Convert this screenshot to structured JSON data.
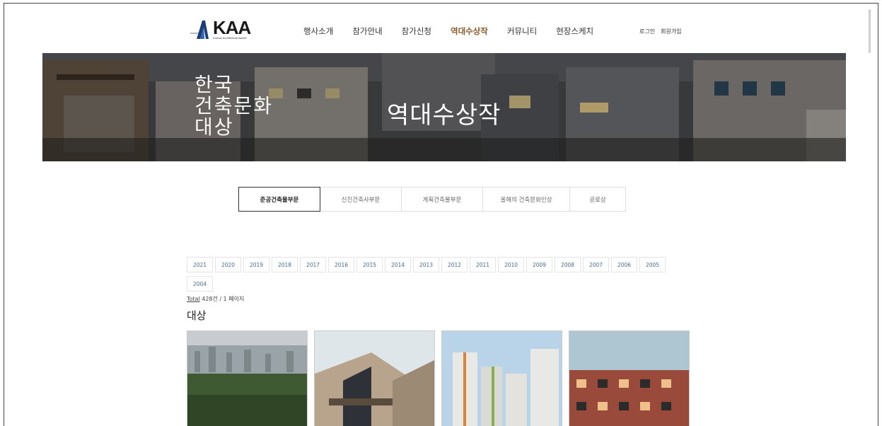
{
  "header": {
    "logo_text": "KAA",
    "logo_sub": "Korean Architecture Award",
    "nav": [
      "행사소개",
      "참가안내",
      "참가신청",
      "역대수상작",
      "커뮤니티",
      "현장스케치"
    ],
    "active_nav": "역대수상작",
    "util": [
      "로그인",
      "회원가입"
    ]
  },
  "hero": {
    "title": "역대수상작",
    "logo_lines": [
      "한국",
      "건축문화",
      "대상"
    ]
  },
  "tabs": [
    "준공건축물부문",
    "신진건축사부문",
    "계획건축물부문",
    "올해의 건축문화인상",
    "공로상"
  ],
  "selected_tab": "준공건축물부문",
  "years": [
    "2021",
    "2020",
    "2019",
    "2018",
    "2017",
    "2016",
    "2015",
    "2014",
    "2013",
    "2012",
    "2011",
    "2010",
    "2009",
    "2008",
    "2007",
    "2006",
    "2005",
    "2004"
  ],
  "total": {
    "label": "Total",
    "text": "428건 / 1 페이지"
  },
  "section_title": "대상",
  "cards": [
    {
      "name": "card-1"
    },
    {
      "name": "card-2"
    },
    {
      "name": "card-3"
    },
    {
      "name": "card-4"
    }
  ]
}
